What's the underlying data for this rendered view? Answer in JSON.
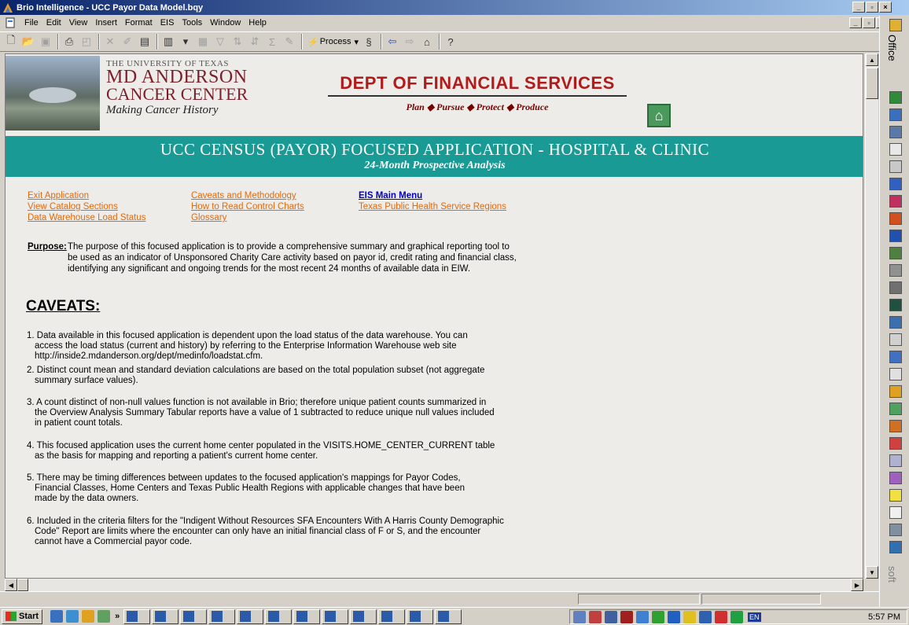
{
  "window": {
    "title": "Brio Intelligence - UCC Payor Data Model.bqy",
    "min": "_",
    "max": "▫",
    "close": "×"
  },
  "menu": [
    "File",
    "Edit",
    "View",
    "Insert",
    "Format",
    "EIS",
    "Tools",
    "Window",
    "Help"
  ],
  "toolbar": {
    "process_label": "Process"
  },
  "header": {
    "uni_line1": "THE UNIVERSITY OF TEXAS",
    "uni_line2": "MD ANDERSON",
    "uni_line3": "CANCER CENTER",
    "uni_tagline": "Making Cancer History",
    "dept_title": "DEPT OF FINANCIAL SERVICES",
    "dept_motto": "Plan ◆ Pursue ◆ Protect ◆ Produce"
  },
  "banner": {
    "title": "UCC CENSUS (PAYOR) FOCUSED APPLICATION - HOSPITAL & CLINIC",
    "subtitle": "24-Month Prospective Analysis"
  },
  "links": {
    "exit": "Exit Application",
    "catalog": "View Catalog Sections",
    "dw": "Data Warehouse Load Status",
    "caveats": "Caveats and Methodology",
    "howto": "How to Read Control Charts",
    "glossary": "Glossary",
    "eis": "EIS Main Menu",
    "tphs": "Texas Public Health Service Regions"
  },
  "purpose": {
    "label": "Purpose:",
    "line1": "The purpose of this focused application is to provide a comprehensive summary and graphical reporting tool to",
    "line2": "be used as an indicator of Unsponsored Charity Care activity based on payor id, credit rating and financial class,",
    "line3": "identifying any significant and ongoing trends for the most recent 24 months of available data in EIW."
  },
  "caveats": {
    "heading": "CAVEATS:",
    "c1": [
      "1. Data available in this focused application is dependent upon the load status of the data warehouse. You can",
      "access the load status (current and history) by referring to the Enterprise Information Warehouse web site",
      "http://inside2.mdanderson.org/dept/medinfo/loadstat.cfm."
    ],
    "c2": [
      "2. Distinct count mean and standard deviation calculations are based on the total population subset (not aggregate",
      "summary surface values)."
    ],
    "c3": [
      "3. A count distinct of non-null values function is not available in Brio; therefore unique patient counts summarized in",
      "the Overview Analysis Summary Tabular reports have a value of 1 subtracted to reduce unique null values included",
      "in patient count totals."
    ],
    "c4": [
      "4. This focused application uses the current home center populated in the VISITS.HOME_CENTER_CURRENT table",
      "as the basis for mapping and reporting a patient's current home center."
    ],
    "c5": [
      "5. There may be timing differences between updates to the focused application's mappings for Payor Codes,",
      "Financial Classes, Home Centers and Texas Public Health Regions with applicable changes that have been",
      "made by the data owners."
    ],
    "c6": [
      "6. Included in the criteria filters for the \"Indigent Without Resources SFA Encounters With A Harris County Demographic",
      "Code\" Report are limits where the encounter can only have an initial financial class of F or S, and the encounter",
      "cannot have a Commercial payor code."
    ]
  },
  "officebar": {
    "label": "Office",
    "label2": "soft"
  },
  "taskbar": {
    "start": "Start",
    "clock": "5:57 PM",
    "lang": "EN",
    "more": "»"
  }
}
